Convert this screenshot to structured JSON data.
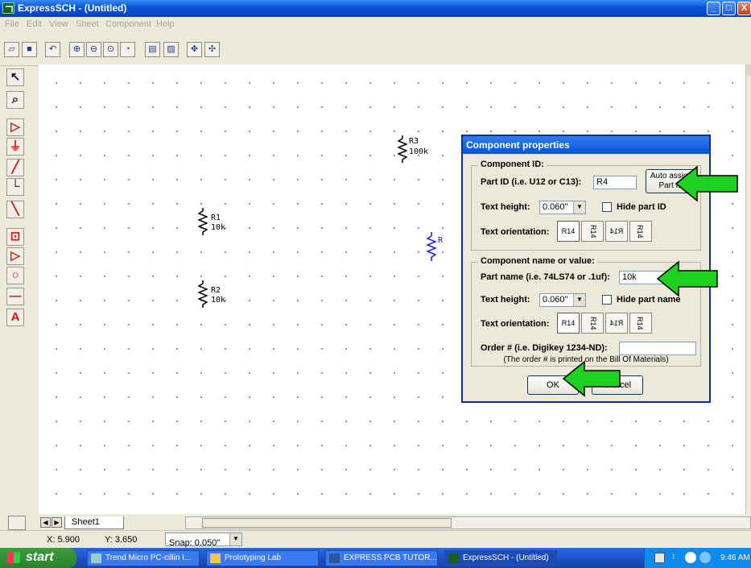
{
  "window": {
    "title": "ExpressSCH - (Untitled)",
    "minimize": "_",
    "maximize": "□",
    "close": "X"
  },
  "menu": [
    "File",
    "Edit",
    "View",
    "Sheet",
    "Component",
    "Help"
  ],
  "toolbar": [
    "open-icon",
    "save-icon",
    "undo-icon",
    "zoom-in-icon",
    "zoom-out-icon",
    "zoom-area-icon",
    "zoom-fit-icon",
    "properties-icon",
    "bom-icon",
    "pan-icon",
    "center-icon"
  ],
  "left_tools": [
    "select-icon",
    "zoom-box-icon",
    "amp-icon",
    "ground-icon",
    "diagonal-wire-icon",
    "wire-icon",
    "line-icon",
    "ic-icon",
    "op-amp-icon",
    "circle-icon",
    "pin-icon",
    "text-icon"
  ],
  "components": [
    {
      "ref": "R3",
      "value": "100k"
    },
    {
      "ref": "R1",
      "value": "10k"
    },
    {
      "ref": "R2",
      "value": "10k"
    },
    {
      "ref": "R",
      "value": ""
    }
  ],
  "sheet_tab": "Sheet1",
  "status": {
    "x": "X: 5.900",
    "y": "Y: 3.650",
    "snap": "Snap: 0.050\""
  },
  "dialog": {
    "title": "Component properties",
    "component_id_group": "Component ID:",
    "part_id_label": "Part ID (i.e. U12 or C13):",
    "part_id_value": "R4",
    "auto_assign": "Auto assign Part ID",
    "text_height_label": "Text height:",
    "text_height_value": "0.060\"",
    "hide_part_id": "Hide part ID",
    "text_orientation_label": "Text orientation:",
    "orient_options": [
      "R14",
      "R14",
      "R14",
      "R14"
    ],
    "name_group": "Component name or value:",
    "part_name_label": "Part name (i.e. 74LS74 or .1uf):",
    "part_name_value": "10k",
    "text_height2_value": "0.060\"",
    "hide_part_name": "Hide part name",
    "order_label": "Order # (i.e. Digikey 1234-ND):",
    "order_value": "",
    "order_note": "(The order # is printed on the Bill Of Materials)",
    "ok": "OK",
    "cancel": "Cancel"
  },
  "taskbar": {
    "start": "start",
    "tasks": [
      "Trend Micro PC-cillin I...",
      "Prototyping Lab",
      "EXPRESS PCB TUTOR...",
      "ExpressSCH - (Untitled)"
    ],
    "clock": "9:46 AM"
  }
}
